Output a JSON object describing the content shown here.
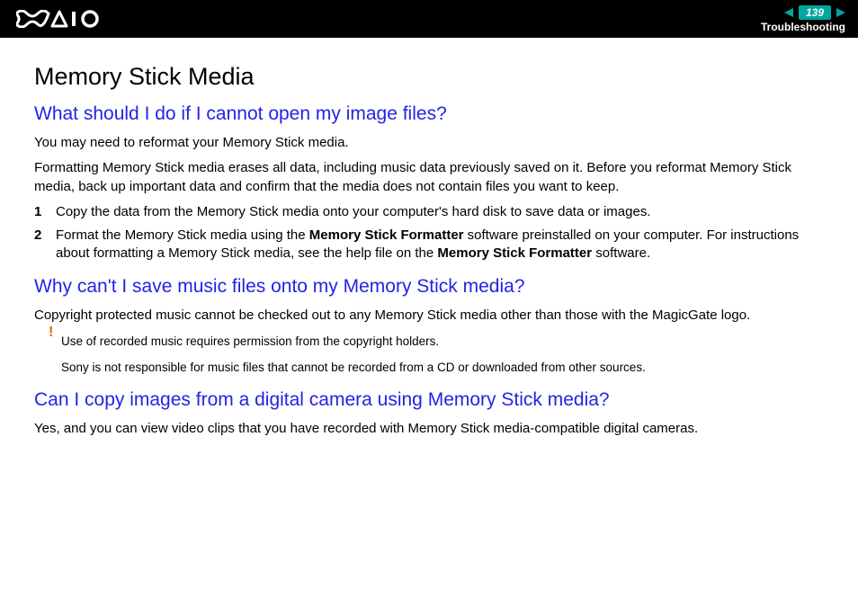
{
  "header": {
    "page_number": "139",
    "section": "Troubleshooting"
  },
  "title": "Memory Stick Media",
  "q1": {
    "heading": "What should I do if I cannot open my image files?",
    "p1": "You may need to reformat your Memory Stick media.",
    "p2": "Formatting Memory Stick media erases all data, including music data previously saved on it. Before you reformat Memory Stick media, back up important data and confirm that the media does not contain files you want to keep.",
    "step1_n": "1",
    "step1_t": "Copy the data from the Memory Stick media onto your computer's hard disk to save data or images.",
    "step2_n": "2",
    "step2_t_a": "Format the Memory Stick media using the ",
    "step2_bold1": "Memory Stick Formatter",
    "step2_t_b": " software preinstalled on your computer. For instructions about formatting a Memory Stick media, see the help file on the ",
    "step2_bold2": "Memory Stick Formatter",
    "step2_t_c": " software."
  },
  "q2": {
    "heading": "Why can't I save music files onto my Memory Stick media?",
    "p1": "Copyright protected music cannot be checked out to any Memory Stick media other than those with the MagicGate logo.",
    "bang": "!",
    "notice1": "Use of recorded music requires permission from the copyright holders.",
    "notice2": "Sony is not responsible for music files that cannot be recorded from a CD or downloaded from other sources."
  },
  "q3": {
    "heading": "Can I copy images from a digital camera using Memory Stick media?",
    "p1": "Yes, and you can view video clips that you have recorded with Memory Stick media-compatible digital cameras."
  }
}
